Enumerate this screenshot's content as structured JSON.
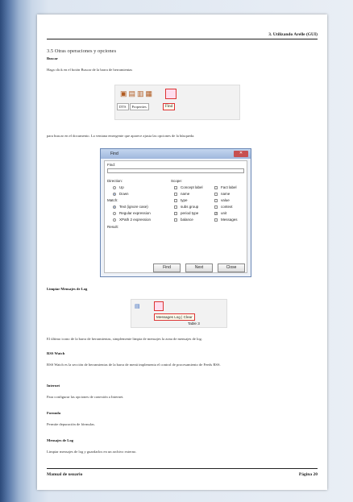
{
  "header": {
    "chapter": "3.   Utilizando Arelle (GUI)"
  },
  "section_title": "3.5 Otras operaciones y opciones",
  "buscar": {
    "heading": "Buscar",
    "text": "Haga click en el botón Buscar de la barra de herramientas",
    "after_text": "para buscar en el documento. La ventana emergente que aparece ajusta las opciones de la búsqueda."
  },
  "toolbar_shot": {
    "tabs": [
      "DTS",
      "Properties"
    ],
    "tooltip": "Find"
  },
  "find_dialog": {
    "title": "Find",
    "find_label": "Find:",
    "direction_label": "Direction:",
    "directions": [
      {
        "label": "Up",
        "selected": false
      },
      {
        "label": "Down",
        "selected": true
      }
    ],
    "match_label": "Match:",
    "matches": [
      {
        "label": "Text (ignore case)",
        "selected": true
      },
      {
        "label": "Regular expression",
        "selected": false
      },
      {
        "label": "XPath 2 expression",
        "selected": false
      }
    ],
    "scope_label": "Scope:",
    "scope_col1": [
      {
        "label": "Concept label",
        "checked": false
      },
      {
        "label": "name",
        "checked": false
      },
      {
        "label": "type",
        "checked": false
      },
      {
        "label": "subs group",
        "checked": false
      },
      {
        "label": "period type",
        "checked": false
      },
      {
        "label": "balance",
        "checked": false
      }
    ],
    "scope_col2": [
      {
        "label": "Fact label",
        "checked": false
      },
      {
        "label": "name",
        "checked": false
      },
      {
        "label": "value",
        "checked": false
      },
      {
        "label": "context",
        "checked": false
      },
      {
        "label": "unit",
        "checked": true
      },
      {
        "label": "Messages",
        "checked": false
      }
    ],
    "result_label": "Result:",
    "buttons": [
      "Find",
      "Next",
      "Close"
    ]
  },
  "limpiar": {
    "heading": "Limpiar Mensajes de Log",
    "tooltip": "Messages Log | Clear",
    "table_label": "Table 3",
    "text": "El último icono de la barra de herramientas, simplemente limpia de mensajes la zona de mensajes de log."
  },
  "rss": {
    "heading": "RSS Watch",
    "text": "RSS Watch es la sección de herramientas de la barra de menú implementa el control de procesamiento de Feeds RSS."
  },
  "internet": {
    "heading": "Internet",
    "text": "Para configurar las opciones de conexión a Internet."
  },
  "formula": {
    "heading": "Formula",
    "text": "Permite depuración de fórmulas."
  },
  "mensajes": {
    "heading": "Mensajes de Log",
    "text": "Limpiar mensajes de log y guardarlos en un archivo externo."
  },
  "footer": {
    "left": "Manual de usuario",
    "right": "Página 20"
  }
}
